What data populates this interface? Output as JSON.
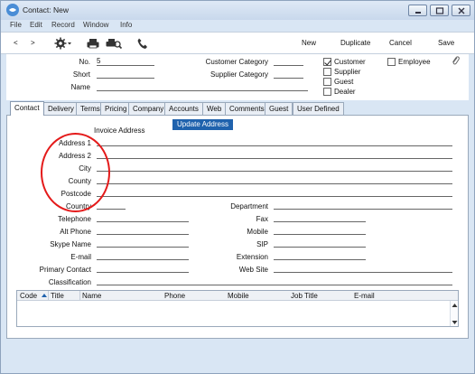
{
  "window": {
    "title": "Contact: New"
  },
  "menu": [
    "File",
    "Edit",
    "Record",
    "Window",
    "Info"
  ],
  "toolbar": {
    "nav_prev": "<",
    "nav_next": ">",
    "new": "New",
    "duplicate": "Duplicate",
    "cancel": "Cancel",
    "save": "Save"
  },
  "header": {
    "no_label": "No.",
    "no_value": "5",
    "short_label": "Short",
    "name_label": "Name",
    "customer_category_label": "Customer Category",
    "supplier_category_label": "Supplier Category",
    "checkboxes": [
      {
        "label": "Customer",
        "checked": true
      },
      {
        "label": "Supplier",
        "checked": false
      },
      {
        "label": "Guest",
        "checked": false
      },
      {
        "label": "Dealer",
        "checked": false
      }
    ],
    "employee": {
      "label": "Employee",
      "checked": false
    }
  },
  "tabs": [
    "Contact",
    "Delivery",
    "Terms",
    "Pricing",
    "Company",
    "Accounts",
    "Web",
    "Comments",
    "Guest",
    "User Defined"
  ],
  "active_tab": "Contact",
  "contact": {
    "update_address_button": "Update Address",
    "invoice_address_label": "Invoice Address",
    "address1": "Address 1",
    "address2": "Address 2",
    "city": "City",
    "county": "County",
    "postcode": "Postcode",
    "country": "Country",
    "department": "Department",
    "telephone": "Telephone",
    "fax": "Fax",
    "alt_phone": "Alt Phone",
    "mobile": "Mobile",
    "skype": "Skype Name",
    "sip": "SIP",
    "email": "E-mail",
    "extension": "Extension",
    "primary_contact": "Primary Contact",
    "web_site": "Web Site",
    "classification": "Classification"
  },
  "grid": {
    "columns": [
      "Code",
      "Title",
      "Name",
      "Phone",
      "Mobile",
      "Job Title",
      "E-mail"
    ]
  },
  "colors": {
    "accent": "#1f62ad",
    "annotation": "#e41a1a",
    "window_bg": "#d9e6f4"
  }
}
